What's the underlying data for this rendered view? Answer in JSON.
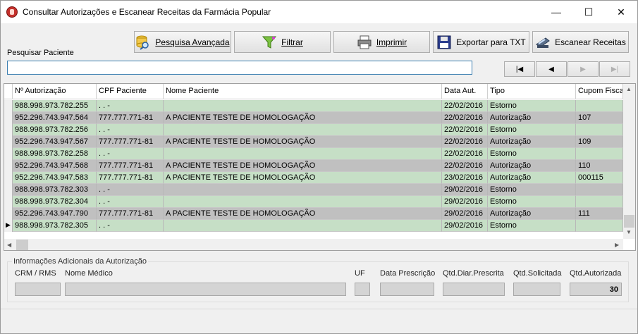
{
  "window": {
    "title": "Consultar Autorizações e Escanear Receitas da Farmácia Popular",
    "minimize_glyph": "—",
    "maximize_glyph": "☐",
    "close_glyph": "✕"
  },
  "toolbar": {
    "pesquisa_avancada": "Pesquisa Avançada",
    "filtrar": "Filtrar",
    "imprimir": "Imprimir",
    "exportar": "Exportar para TXT",
    "escanear": "Escanear Receitas"
  },
  "icons": {
    "pesquisa_avancada": "database-search-icon",
    "filtrar": "funnel-icon",
    "imprimir": "printer-icon",
    "exportar": "floppy-disk-icon",
    "escanear": "scanner-icon"
  },
  "search": {
    "label": "Pesquisar Paciente",
    "value": ""
  },
  "nav": {
    "first": "|◀",
    "prev": "◀",
    "next": "▶",
    "last": "▶|"
  },
  "grid": {
    "columns": [
      "Nº Autorização",
      "CPF Paciente",
      "Nome Paciente",
      "Data Aut.",
      "Tipo",
      "Cupom Fiscal"
    ],
    "rows": [
      [
        "988.998.973.782.255",
        "   .   .   -",
        "",
        "22/02/2016",
        "Estorno",
        ""
      ],
      [
        "952.296.743.947.564",
        "777.777.771-81",
        "A PACIENTE TESTE DE HOMOLOGAÇÃO",
        "22/02/2016",
        "Autorização",
        "107"
      ],
      [
        "988.998.973.782.256",
        "   .   .   -",
        "",
        "22/02/2016",
        "Estorno",
        ""
      ],
      [
        "952.296.743.947.567",
        "777.777.771-81",
        "A PACIENTE TESTE DE HOMOLOGAÇÃO",
        "22/02/2016",
        "Autorização",
        "109"
      ],
      [
        "988.998.973.782.258",
        "   .   .   -",
        "",
        "22/02/2016",
        "Estorno",
        ""
      ],
      [
        "952.296.743.947.568",
        "777.777.771-81",
        "A PACIENTE TESTE DE HOMOLOGAÇÃO",
        "22/02/2016",
        "Autorização",
        "110"
      ],
      [
        "952.296.743.947.583",
        "777.777.771-81",
        "A PACIENTE TESTE DE HOMOLOGAÇÃO",
        "23/02/2016",
        "Autorização",
        "000115"
      ],
      [
        "988.998.973.782.303",
        "   .   .   -",
        "",
        "29/02/2016",
        "Estorno",
        ""
      ],
      [
        "988.998.973.782.304",
        "   .   .   -",
        "",
        "29/02/2016",
        "Estorno",
        ""
      ],
      [
        "952.296.743.947.790",
        "777.777.771-81",
        "A PACIENTE TESTE DE HOMOLOGAÇÃO",
        "29/02/2016",
        "Autorização",
        "111"
      ],
      [
        "988.998.973.782.305",
        "   .   .   -",
        "",
        "29/02/2016",
        "Estorno",
        ""
      ]
    ],
    "row_colors": [
      "green",
      "gray",
      "green",
      "gray",
      "green",
      "gray",
      "green",
      "gray",
      "green",
      "gray",
      "green"
    ],
    "current_row_index": 10
  },
  "details": {
    "group_title": "Informações Adicionais da Autorização",
    "labels": {
      "crm": "CRM / RMS",
      "medico": "Nome Médico",
      "uf": "UF",
      "data_prescricao": "Data Prescrição",
      "qtd_diar": "Qtd.Diar.Prescrita",
      "qtd_solicitada": "Qtd.Solicitada",
      "qtd_autorizada": "Qtd.Autorizada"
    },
    "values": {
      "crm": "",
      "medico": "",
      "uf": "",
      "data_prescricao": "",
      "qtd_diar": "",
      "qtd_solicitada": "",
      "qtd_autorizada": "30"
    }
  },
  "colors": {
    "row_green": "#c6dfc6",
    "row_gray": "#c0c0c0",
    "search_border": "#3c7fb1"
  }
}
